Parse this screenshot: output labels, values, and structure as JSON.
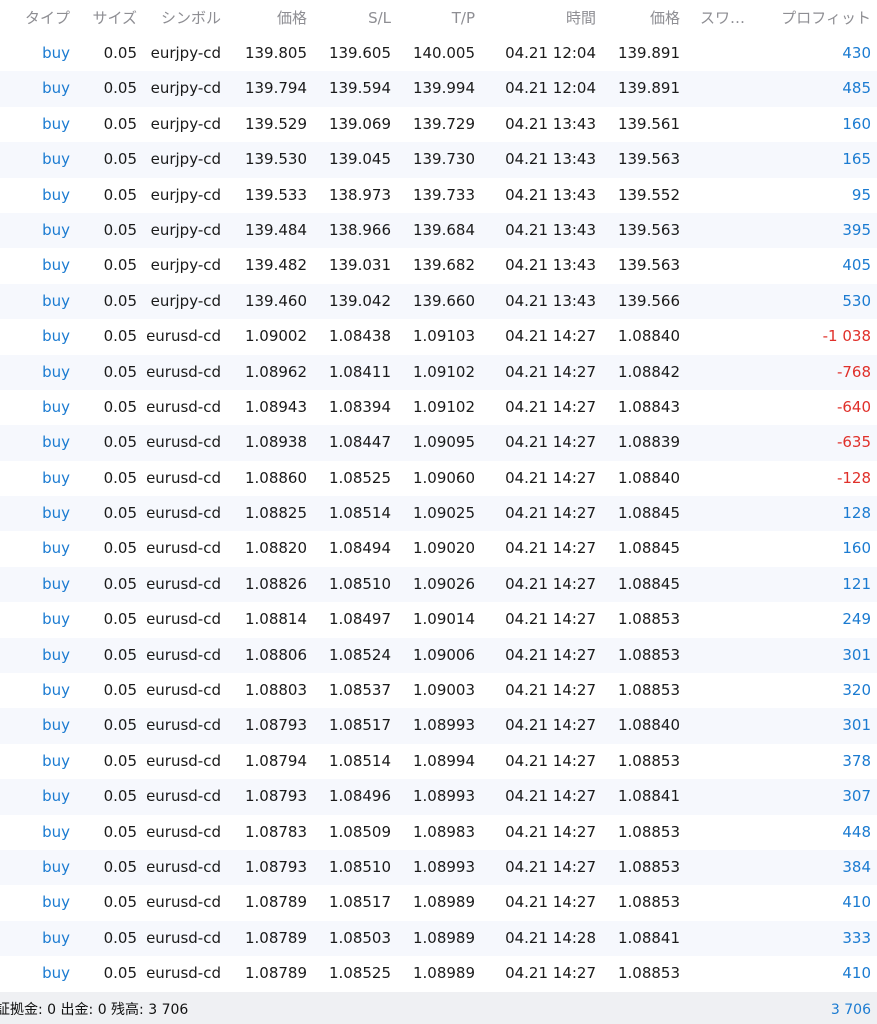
{
  "header": {
    "type": "タイプ",
    "size": "サイズ",
    "symbol": "シンボル",
    "price": "価格",
    "sl": "S/L",
    "tp": "T/P",
    "time": "時間",
    "price2": "価格",
    "swap": "スワ…",
    "profit": "プロフィット"
  },
  "colors": {
    "accent_blue": "#1b7bd1",
    "loss_red": "#e0302a",
    "header_gray": "#8e8e93",
    "row_stripe": "#f6f8fd",
    "footer_bg": "#eff0f3"
  },
  "rows": [
    {
      "type": "buy",
      "size": "0.05",
      "symbol": "eurjpy-cd",
      "price": "139.805",
      "sl": "139.605",
      "tp": "140.005",
      "time": "04.21 12:04",
      "price2": "139.891",
      "profit": "430"
    },
    {
      "type": "buy",
      "size": "0.05",
      "symbol": "eurjpy-cd",
      "price": "139.794",
      "sl": "139.594",
      "tp": "139.994",
      "time": "04.21 12:04",
      "price2": "139.891",
      "profit": "485"
    },
    {
      "type": "buy",
      "size": "0.05",
      "symbol": "eurjpy-cd",
      "price": "139.529",
      "sl": "139.069",
      "tp": "139.729",
      "time": "04.21 13:43",
      "price2": "139.561",
      "profit": "160"
    },
    {
      "type": "buy",
      "size": "0.05",
      "symbol": "eurjpy-cd",
      "price": "139.530",
      "sl": "139.045",
      "tp": "139.730",
      "time": "04.21 13:43",
      "price2": "139.563",
      "profit": "165"
    },
    {
      "type": "buy",
      "size": "0.05",
      "symbol": "eurjpy-cd",
      "price": "139.533",
      "sl": "138.973",
      "tp": "139.733",
      "time": "04.21 13:43",
      "price2": "139.552",
      "profit": "95"
    },
    {
      "type": "buy",
      "size": "0.05",
      "symbol": "eurjpy-cd",
      "price": "139.484",
      "sl": "138.966",
      "tp": "139.684",
      "time": "04.21 13:43",
      "price2": "139.563",
      "profit": "395"
    },
    {
      "type": "buy",
      "size": "0.05",
      "symbol": "eurjpy-cd",
      "price": "139.482",
      "sl": "139.031",
      "tp": "139.682",
      "time": "04.21 13:43",
      "price2": "139.563",
      "profit": "405"
    },
    {
      "type": "buy",
      "size": "0.05",
      "symbol": "eurjpy-cd",
      "price": "139.460",
      "sl": "139.042",
      "tp": "139.660",
      "time": "04.21 13:43",
      "price2": "139.566",
      "profit": "530"
    },
    {
      "type": "buy",
      "size": "0.05",
      "symbol": "eurusd-cd",
      "price": "1.09002",
      "sl": "1.08438",
      "tp": "1.09103",
      "time": "04.21 14:27",
      "price2": "1.08840",
      "profit": "-1 038"
    },
    {
      "type": "buy",
      "size": "0.05",
      "symbol": "eurusd-cd",
      "price": "1.08962",
      "sl": "1.08411",
      "tp": "1.09102",
      "time": "04.21 14:27",
      "price2": "1.08842",
      "profit": "-768"
    },
    {
      "type": "buy",
      "size": "0.05",
      "symbol": "eurusd-cd",
      "price": "1.08943",
      "sl": "1.08394",
      "tp": "1.09102",
      "time": "04.21 14:27",
      "price2": "1.08843",
      "profit": "-640"
    },
    {
      "type": "buy",
      "size": "0.05",
      "symbol": "eurusd-cd",
      "price": "1.08938",
      "sl": "1.08447",
      "tp": "1.09095",
      "time": "04.21 14:27",
      "price2": "1.08839",
      "profit": "-635"
    },
    {
      "type": "buy",
      "size": "0.05",
      "symbol": "eurusd-cd",
      "price": "1.08860",
      "sl": "1.08525",
      "tp": "1.09060",
      "time": "04.21 14:27",
      "price2": "1.08840",
      "profit": "-128"
    },
    {
      "type": "buy",
      "size": "0.05",
      "symbol": "eurusd-cd",
      "price": "1.08825",
      "sl": "1.08514",
      "tp": "1.09025",
      "time": "04.21 14:27",
      "price2": "1.08845",
      "profit": "128"
    },
    {
      "type": "buy",
      "size": "0.05",
      "symbol": "eurusd-cd",
      "price": "1.08820",
      "sl": "1.08494",
      "tp": "1.09020",
      "time": "04.21 14:27",
      "price2": "1.08845",
      "profit": "160"
    },
    {
      "type": "buy",
      "size": "0.05",
      "symbol": "eurusd-cd",
      "price": "1.08826",
      "sl": "1.08510",
      "tp": "1.09026",
      "time": "04.21 14:27",
      "price2": "1.08845",
      "profit": "121"
    },
    {
      "type": "buy",
      "size": "0.05",
      "symbol": "eurusd-cd",
      "price": "1.08814",
      "sl": "1.08497",
      "tp": "1.09014",
      "time": "04.21 14:27",
      "price2": "1.08853",
      "profit": "249"
    },
    {
      "type": "buy",
      "size": "0.05",
      "symbol": "eurusd-cd",
      "price": "1.08806",
      "sl": "1.08524",
      "tp": "1.09006",
      "time": "04.21 14:27",
      "price2": "1.08853",
      "profit": "301"
    },
    {
      "type": "buy",
      "size": "0.05",
      "symbol": "eurusd-cd",
      "price": "1.08803",
      "sl": "1.08537",
      "tp": "1.09003",
      "time": "04.21 14:27",
      "price2": "1.08853",
      "profit": "320"
    },
    {
      "type": "buy",
      "size": "0.05",
      "symbol": "eurusd-cd",
      "price": "1.08793",
      "sl": "1.08517",
      "tp": "1.08993",
      "time": "04.21 14:27",
      "price2": "1.08840",
      "profit": "301"
    },
    {
      "type": "buy",
      "size": "0.05",
      "symbol": "eurusd-cd",
      "price": "1.08794",
      "sl": "1.08514",
      "tp": "1.08994",
      "time": "04.21 14:27",
      "price2": "1.08853",
      "profit": "378"
    },
    {
      "type": "buy",
      "size": "0.05",
      "symbol": "eurusd-cd",
      "price": "1.08793",
      "sl": "1.08496",
      "tp": "1.08993",
      "time": "04.21 14:27",
      "price2": "1.08841",
      "profit": "307"
    },
    {
      "type": "buy",
      "size": "0.05",
      "symbol": "eurusd-cd",
      "price": "1.08783",
      "sl": "1.08509",
      "tp": "1.08983",
      "time": "04.21 14:27",
      "price2": "1.08853",
      "profit": "448"
    },
    {
      "type": "buy",
      "size": "0.05",
      "symbol": "eurusd-cd",
      "price": "1.08793",
      "sl": "1.08510",
      "tp": "1.08993",
      "time": "04.21 14:27",
      "price2": "1.08853",
      "profit": "384"
    },
    {
      "type": "buy",
      "size": "0.05",
      "symbol": "eurusd-cd",
      "price": "1.08789",
      "sl": "1.08517",
      "tp": "1.08989",
      "time": "04.21 14:27",
      "price2": "1.08853",
      "profit": "410"
    },
    {
      "type": "buy",
      "size": "0.05",
      "symbol": "eurusd-cd",
      "price": "1.08789",
      "sl": "1.08503",
      "tp": "1.08989",
      "time": "04.21 14:28",
      "price2": "1.08841",
      "profit": "333"
    },
    {
      "type": "buy",
      "size": "0.05",
      "symbol": "eurusd-cd",
      "price": "1.08789",
      "sl": "1.08525",
      "tp": "1.08989",
      "time": "04.21 14:27",
      "price2": "1.08853",
      "profit": "410"
    }
  ],
  "footer": {
    "summary": "証拠金: 0 出金: 0 残高: 3 706",
    "total_profit": "3 706"
  }
}
